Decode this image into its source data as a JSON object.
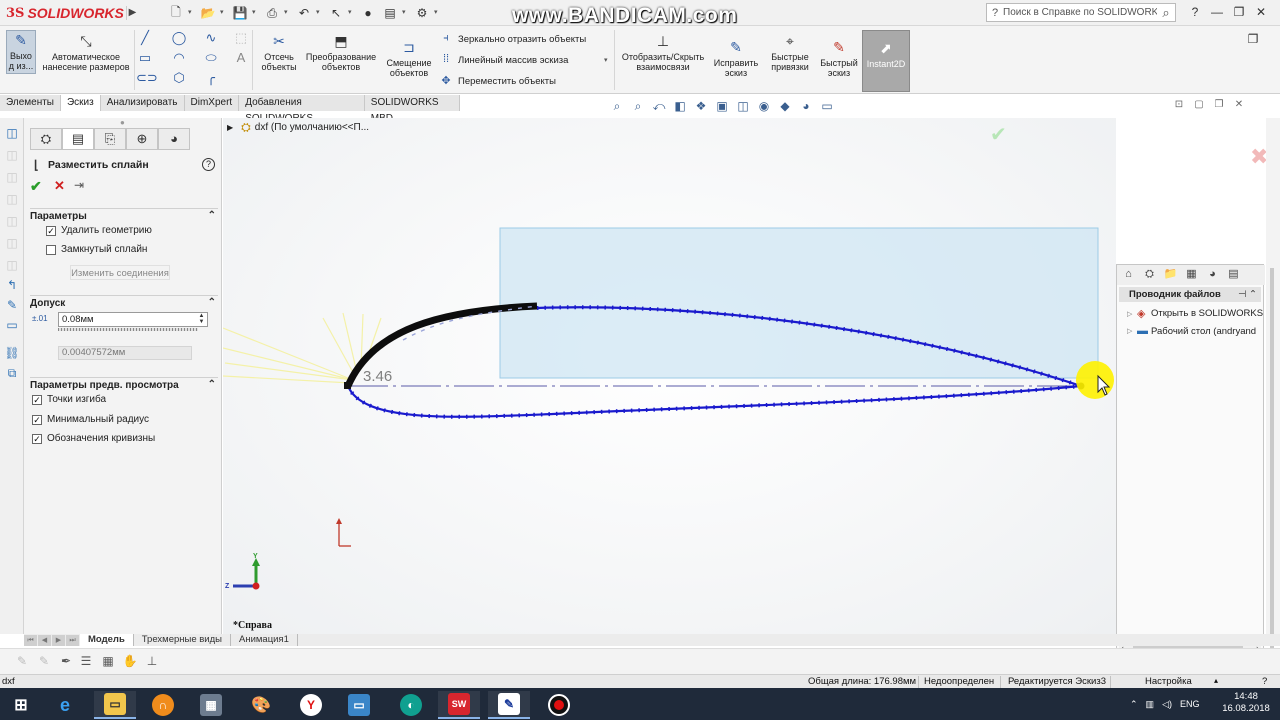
{
  "titlebar": {
    "logo_prefix": "3S",
    "logo_text": "SOLIDWORKS",
    "watermark": "www.BANDICAM.com",
    "help_search_placeholder": "Поиск в Справке по SOLIDWORKS",
    "quick_icons": [
      "new-document-icon",
      "open-icon",
      "save-icon",
      "print-icon",
      "undo-icon",
      "select-icon",
      "traffic-light-icon",
      "file-properties-icon",
      "options-gear-icon"
    ]
  },
  "ribbon": {
    "exit_sketch": "Выхо\nд из...",
    "smart_dimension": "Автоматическое\nнанесение размеров",
    "trim": "Отсечь\nобъекты",
    "convert": "Преобразование\nобъектов",
    "offset": "Смещение\nобъектов",
    "mirror": "Зеркально отразить объекты",
    "linear_pattern": "Линейный массив эскиза",
    "move": "Переместить объекты",
    "display_relations": "Отобразить/Скрыть\nвзаимосвязи",
    "repair_sketch": "Исправить\nэскиз",
    "quick_snaps": "Быстрые\nпривязки",
    "rapid_sketch": "Быстрый\nэскиз",
    "instant2d": "Instant2D"
  },
  "tabs": [
    "Элементы",
    "Эскиз",
    "Анализировать",
    "DimXpert",
    "Добавления SOLIDWORKS",
    "SOLIDWORKS MBD"
  ],
  "active_tab": "Эскиз",
  "feature_tree": {
    "label": "dxf  (По умолчанию<<П..."
  },
  "property_manager": {
    "title": "Разместить сплайн",
    "section_parameters": "Параметры",
    "delete_geometry": "Удалить геометрию",
    "delete_geometry_checked": true,
    "closed_spline": "Замкнутый сплайн",
    "closed_spline_checked": false,
    "change_connections": "Изменить соединения",
    "section_tolerance": "Допуск",
    "tolerance_value": "0.08мм",
    "tolerance_result": "0.00407572мм",
    "section_preview": "Параметры предв. просмотра",
    "inflection_points": "Точки изгиба",
    "inflection_points_checked": true,
    "minimum_radius": "Минимальный радиус",
    "minimum_radius_checked": true,
    "curvature_combs": "Обозначения кривизны",
    "curvature_combs_checked": true
  },
  "graphics": {
    "dimension_label": "3.46",
    "view_name": "*Справа"
  },
  "task_pane": {
    "header": "Проводник файлов",
    "items": [
      "Открыть в SOLIDWORKS",
      "Рабочий стол (andryand"
    ]
  },
  "bottom_tabs": [
    "Модель",
    "Трехмерные виды",
    "Анимация1"
  ],
  "active_bottom_tab": "Модель",
  "statusbar": {
    "file": "dxf",
    "total_length": "Общая длина: 176.98мм",
    "definition": "Недоопределен",
    "editing": "Редактируется Эскиз3",
    "customize": "Настройка"
  },
  "taskbar": {
    "language": "ENG",
    "time": "14:48",
    "date": "16.08.2018",
    "apps": [
      "windows-start-icon",
      "internet-explorer-icon",
      "file-explorer-icon",
      "headphones-app-icon",
      "calculator-icon",
      "paint-icon",
      "yandex-browser-icon",
      "image-viewer-icon",
      "kompas-icon",
      "solidworks-2016-icon",
      "pen-app-icon",
      "bandicam-record-icon"
    ]
  },
  "colors": {
    "spline": "#1a1acd",
    "highlight": "#cfe6f3",
    "accent": "#d8262e",
    "cursor_halo": "#fff200"
  }
}
